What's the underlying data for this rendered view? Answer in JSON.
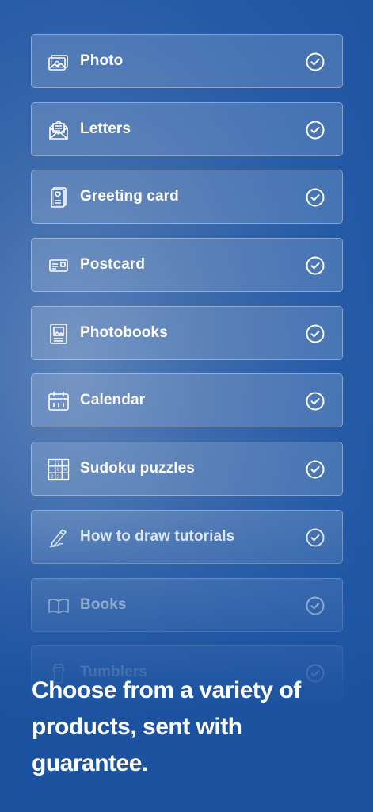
{
  "items": [
    {
      "label": "Photo",
      "icon": "photo-icon"
    },
    {
      "label": "Letters",
      "icon": "letter-envelope-icon"
    },
    {
      "label": "Greeting card",
      "icon": "greeting-card-icon"
    },
    {
      "label": "Postcard",
      "icon": "postcard-icon"
    },
    {
      "label": "Photobooks",
      "icon": "photobook-icon"
    },
    {
      "label": "Calendar",
      "icon": "calendar-icon"
    },
    {
      "label": "Sudoku puzzles",
      "icon": "sudoku-grid-icon"
    },
    {
      "label": "How to draw tutorials",
      "icon": "pencil-draw-icon"
    },
    {
      "label": "Books",
      "icon": "open-book-icon"
    },
    {
      "label": "Tumblers",
      "icon": "tumbler-icon"
    }
  ],
  "check_icon": "check-circle-icon",
  "headline": "Choose from a variety of products, sent with guarantee.",
  "colors": {
    "background": "#245aa6",
    "text": "#ffffff"
  }
}
